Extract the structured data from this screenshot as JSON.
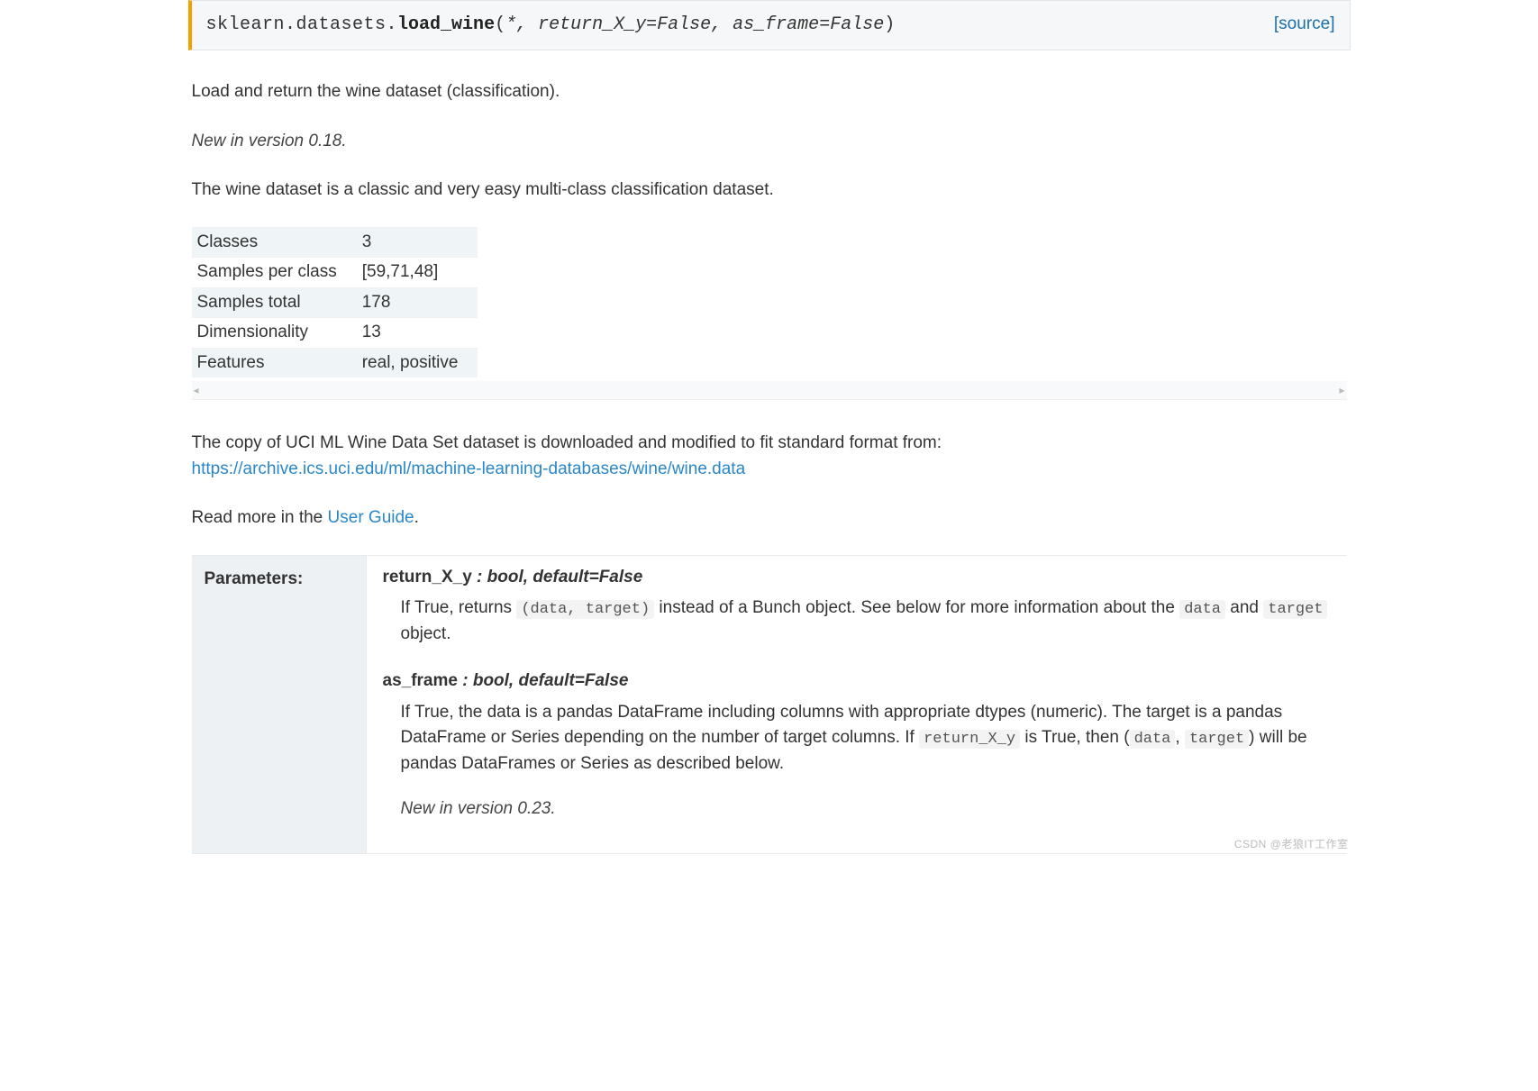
{
  "signature": {
    "module": "sklearn.datasets.",
    "func": "load_wine",
    "open": "(",
    "star": "*",
    "sep1": ", ",
    "p1": "return_X_y=False",
    "sep2": ", ",
    "p2": "as_frame=False",
    "close": ")",
    "source": "[source]"
  },
  "desc": {
    "lead": "Load and return the wine dataset (classification).",
    "new_in": "New in version 0.18.",
    "classic": "The wine dataset is a classic and very easy multi-class classification dataset."
  },
  "meta": {
    "rows": [
      [
        "Classes",
        "3"
      ],
      [
        "Samples per class",
        "[59,71,48]"
      ],
      [
        "Samples total",
        "178"
      ],
      [
        "Dimensionality",
        "13"
      ],
      [
        "Features",
        "real, positive"
      ]
    ]
  },
  "copy": {
    "pre": "The copy of UCI ML Wine Data Set dataset is downloaded and modified to fit standard format from:",
    "url": "https://archive.ics.uci.edu/ml/machine-learning-databases/wine/wine.data"
  },
  "read_more": {
    "pre": "Read more in the ",
    "link": "User Guide",
    "post": "."
  },
  "params": {
    "label": "Parameters:",
    "return_X_y": {
      "name": "return_X_y",
      "classifier": " : bool, default=False",
      "d1": "If True, returns ",
      "code1": "(data, target)",
      "d2": " instead of a Bunch object. See below for more information about the ",
      "code2": "data",
      "d3": " and ",
      "code3": "target",
      "d4": " object."
    },
    "as_frame": {
      "name": "as_frame",
      "classifier": " : bool, default=False",
      "d1": "If True, the data is a pandas DataFrame including columns with appropriate dtypes (numeric). The target is a pandas DataFrame or Series depending on the number of target columns. If ",
      "code1": "return_X_y",
      "d2": " is True, then (",
      "code2": "data",
      "d3": ", ",
      "code3": "target",
      "d4": ") will be pandas DataFrames or Series as described below.",
      "new_in": "New in version 0.23."
    }
  },
  "watermark": "CSDN @老狼IT工作室"
}
